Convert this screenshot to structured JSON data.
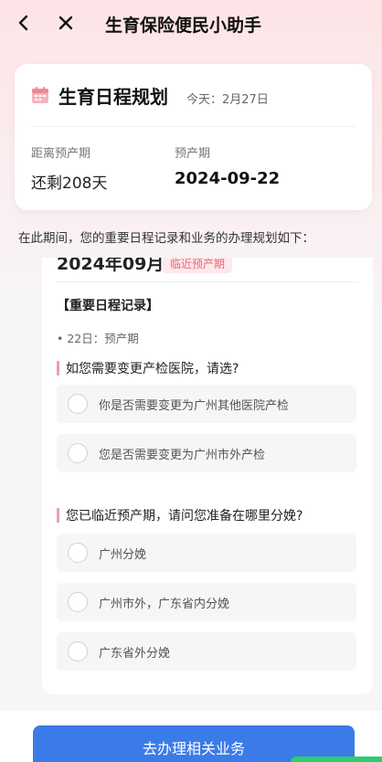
{
  "header": {
    "title": "生育保险便民小助手"
  },
  "card": {
    "title": "生育日程规划",
    "today": "今天：2月27日",
    "remain_label": "距离预产期",
    "remain_value": "还剩208天",
    "due_label": "预产期",
    "due_value": "2024-09-22"
  },
  "intro": "在此期间，您的重要日程记录和业务的办理规划如下：",
  "timeline": {
    "month": "2024年09月",
    "tag": "临近预产期",
    "section_title": "【重要日程记录】",
    "event": "• 22日：预产期",
    "questions": [
      {
        "text": "如您需要变更产检医院，请选?",
        "options": [
          "你是否需要变更为广州其他医院产检",
          "您是否需要变更为广州市外产检"
        ]
      },
      {
        "text": "您已临近预产期，请问您准备在哪里分娩?",
        "options": [
          "广州分娩",
          "广州市外，广东省内分娩",
          "广东省外分娩"
        ]
      }
    ]
  },
  "action": {
    "label": "去办理相关业务"
  },
  "colors": {
    "accent": "#3b7be8",
    "tag": "#e8657a",
    "bar": "#e8a0aa"
  }
}
